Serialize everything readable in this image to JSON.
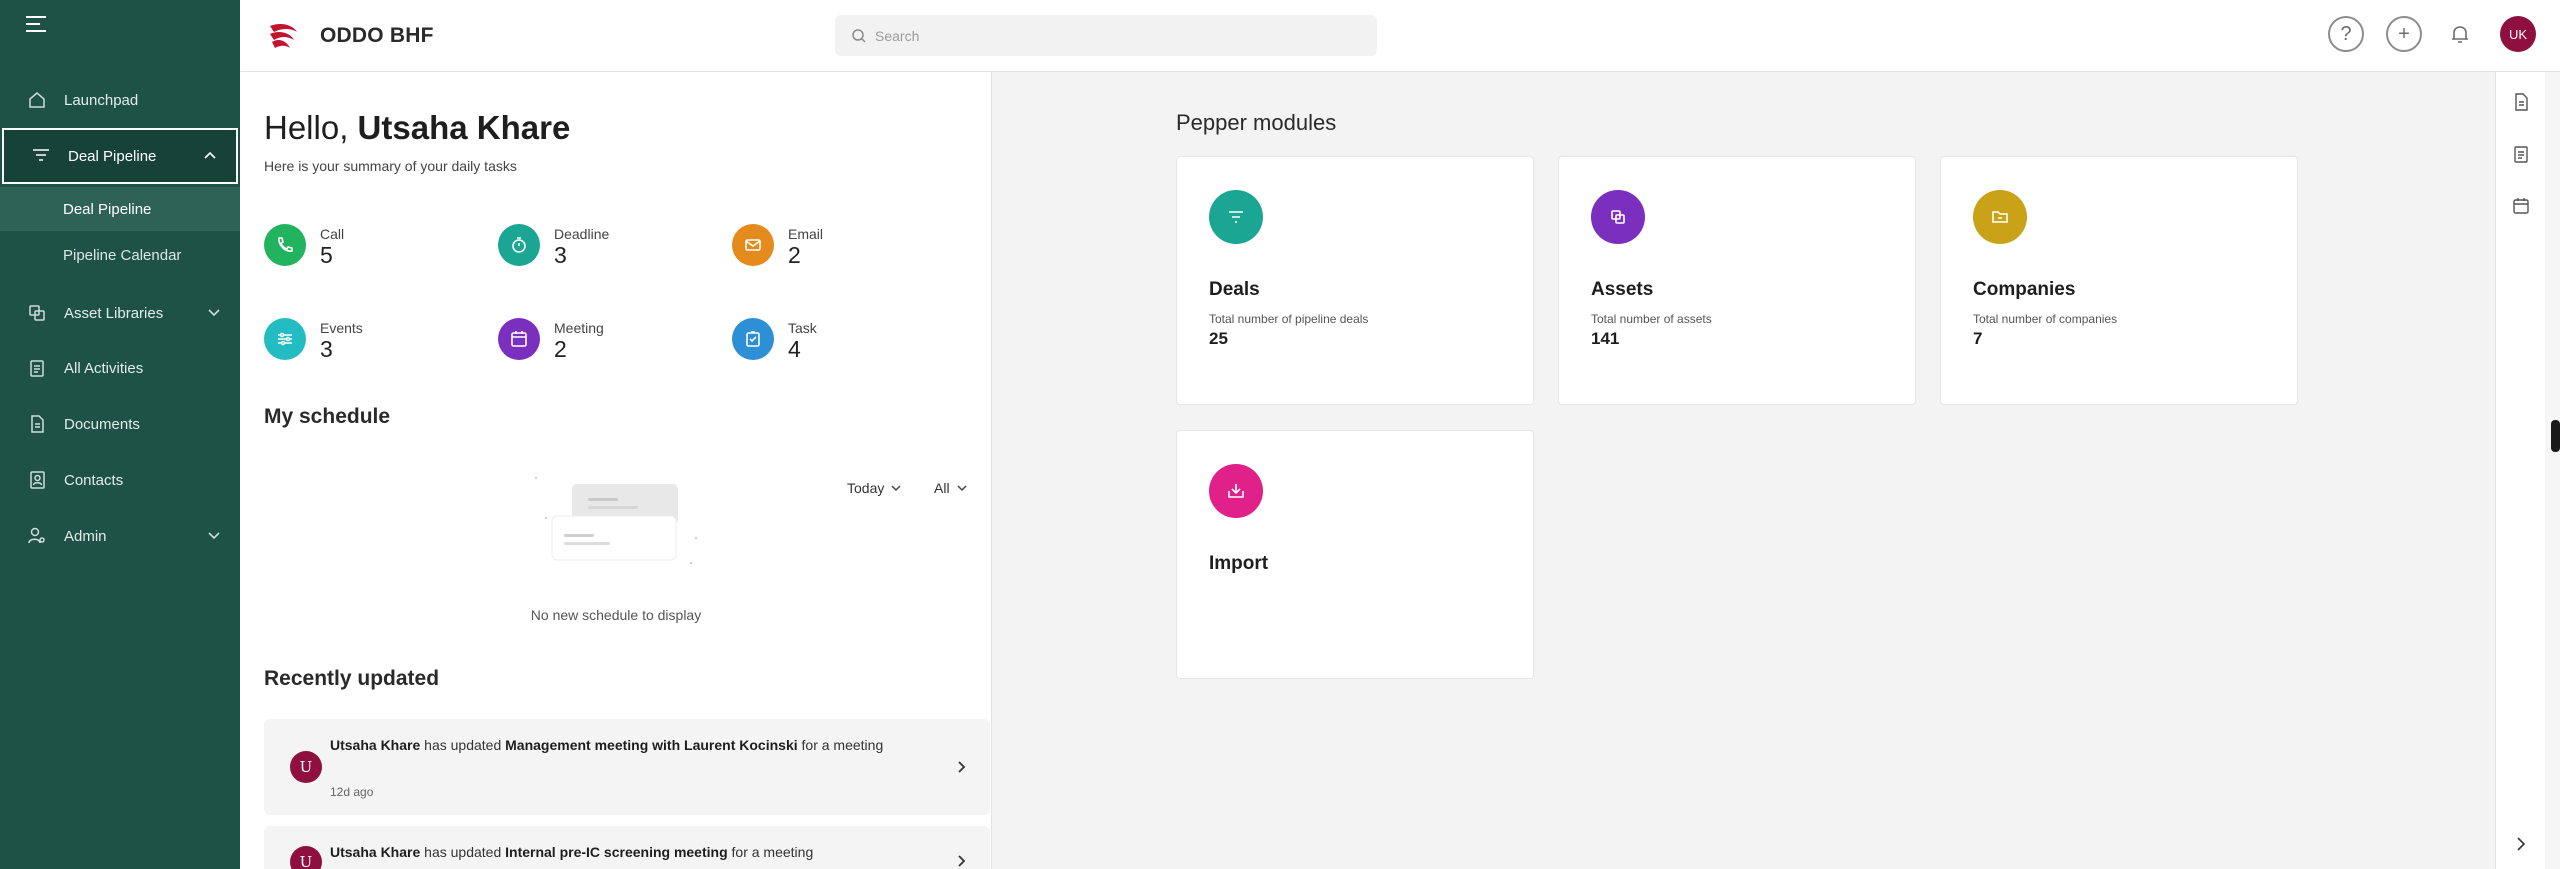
{
  "sidebar": {
    "items": [
      {
        "label": "Launchpad"
      },
      {
        "label": "Deal Pipeline"
      },
      {
        "label": "Asset Libraries"
      },
      {
        "label": "All Activities"
      },
      {
        "label": "Documents"
      },
      {
        "label": "Contacts"
      },
      {
        "label": "Admin"
      }
    ],
    "sub_items": [
      {
        "label": "Deal Pipeline"
      },
      {
        "label": "Pipeline Calendar"
      }
    ]
  },
  "header": {
    "brand": "ODDO BHF",
    "search_placeholder": "Search",
    "avatar_initials": "UK"
  },
  "greeting": {
    "prefix": "Hello,",
    "name": "Utsaha Khare",
    "subtitle": "Here is your summary of your daily tasks"
  },
  "stats": [
    {
      "label": "Call",
      "value": "5",
      "color": "#22b35e"
    },
    {
      "label": "Deadline",
      "value": "3",
      "color": "#1aa692"
    },
    {
      "label": "Email",
      "value": "2",
      "color": "#e58a1d"
    },
    {
      "label": "Events",
      "value": "3",
      "color": "#22bcc2"
    },
    {
      "label": "Meeting",
      "value": "2",
      "color": "#7b2fbf"
    },
    {
      "label": "Task",
      "value": "4",
      "color": "#2d8fd6"
    }
  ],
  "schedule": {
    "title": "My schedule",
    "filter_day": "Today",
    "filter_type": "All",
    "empty_text": "No new schedule to display"
  },
  "recent": {
    "title": "Recently updated",
    "items": [
      {
        "avatar": "U",
        "user": "Utsaha Khare",
        "action": " has updated ",
        "subject": "Management meeting with Laurent Kocinski",
        "suffix": " for a meeting",
        "time": "12d ago"
      },
      {
        "avatar": "U",
        "user": "Utsaha Khare",
        "action": " has updated ",
        "subject": "Internal pre-IC screening meeting",
        "suffix": " for a meeting",
        "time": ""
      }
    ]
  },
  "modules": {
    "title": "Pepper modules",
    "cards": [
      {
        "title": "Deals",
        "desc": "Total number of pipeline deals",
        "value": "25",
        "color": "#1aa692",
        "icon": "filter-icon"
      },
      {
        "title": "Assets",
        "desc": "Total number of assets",
        "value": "141",
        "color": "#7b2fbf",
        "icon": "assets-icon"
      },
      {
        "title": "Companies",
        "desc": "Total number of companies",
        "value": "7",
        "color": "#c9a217",
        "icon": "folder-icon"
      },
      {
        "title": "Import",
        "desc": "",
        "value": "",
        "color": "#e0218a",
        "icon": "import-icon"
      }
    ]
  },
  "colors": {
    "sidebar_bg": "#1e5246",
    "accent": "#8f0f3f"
  }
}
